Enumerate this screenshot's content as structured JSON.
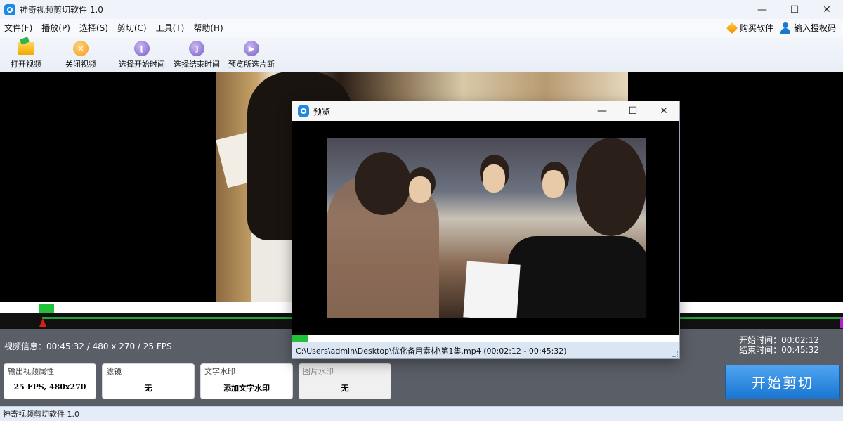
{
  "window": {
    "title": "神奇视频剪切软件 1.0",
    "controls": [
      "—",
      "☐",
      "✕"
    ]
  },
  "menu": {
    "items": [
      "文件(F)",
      "播放(P)",
      "选择(S)",
      "剪切(C)",
      "工具(T)",
      "帮助(H)"
    ],
    "buy": "购买软件",
    "license": "输入授权码"
  },
  "toolbar": {
    "open": "打开视频",
    "close": "关闭视频",
    "select_start": "选择开始时间",
    "select_end": "选择结束时间",
    "preview_segment": "预览所选片断"
  },
  "info": {
    "video_info": "视频信息：00:45:32 / 480 x 270 / 25 FPS",
    "start_time": "开始时间：00:02:12",
    "end_time": "结束时间：00:45:32"
  },
  "cards": {
    "output": {
      "title": "输出视频属性",
      "value": "25 FPS, 480x270"
    },
    "filter": {
      "title": "滤镜",
      "value": "无"
    },
    "text_watermark": {
      "title": "文字水印",
      "value": "添加文字水印"
    },
    "image_watermark": {
      "title": "图片水印",
      "value": "无"
    }
  },
  "start_button": "开始剪切",
  "status": "神奇视频剪切软件 1.0",
  "preview": {
    "title": "预览",
    "progress": 0.04,
    "path": "C:\\Users\\admin\\Desktop\\优化备用素材\\第1集.mp4 (00:02:12 - 00:45:32)"
  },
  "colors": {
    "accent": "#1976d2",
    "timeline_marker": "#22c13a",
    "panel": "#5a5e66"
  }
}
